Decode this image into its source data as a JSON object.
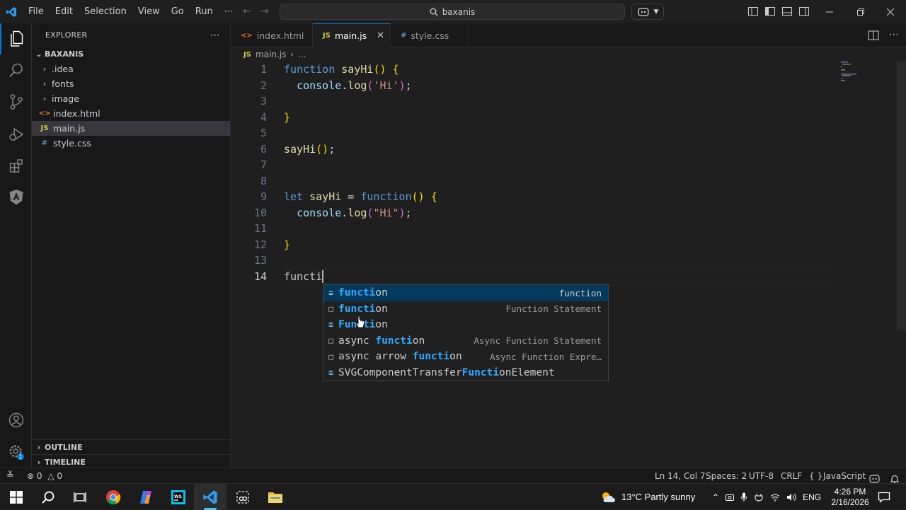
{
  "menu": [
    "File",
    "Edit",
    "Selection",
    "View",
    "Go",
    "Run",
    "⋯"
  ],
  "search": {
    "text": "baxanis"
  },
  "explorer": {
    "title": "EXPLORER",
    "more": "⋯",
    "root": "BAXANIS",
    "items": [
      {
        "label": ".idea",
        "type": "folder"
      },
      {
        "label": "fonts",
        "type": "folder"
      },
      {
        "label": "image",
        "type": "folder"
      },
      {
        "label": "index.html",
        "type": "html",
        "icon": "<>"
      },
      {
        "label": "main.js",
        "type": "js",
        "icon": "JS"
      },
      {
        "label": "style.css",
        "type": "css",
        "icon": "#"
      }
    ],
    "outline": "OUTLINE",
    "timeline": "TIMELINE"
  },
  "tabs": [
    {
      "label": "index.html",
      "icon": "<>"
    },
    {
      "label": "main.js",
      "icon": "JS",
      "close": "✕"
    },
    {
      "label": "style.css",
      "icon": "#"
    }
  ],
  "breadcrumb": {
    "icon": "JS",
    "file": "main.js",
    "sep": "›",
    "more": "..."
  },
  "line_numbers": [
    "1",
    "2",
    "3",
    "4",
    "5",
    "6",
    "7",
    "8",
    "9",
    "10",
    "11",
    "12",
    "13",
    "14"
  ],
  "code": {
    "l1": {
      "kw": "function",
      "name": "sayHi",
      "parens": "()",
      "brace": "{"
    },
    "l2": {
      "obj": "console",
      "dot": ".",
      "method": "log",
      "open": "(",
      "str": "'Hi'",
      "close": ");"
    },
    "l4": "}",
    "l6": {
      "name": "sayHi",
      "rest": "();"
    },
    "l9": {
      "kw": "let",
      "name": "sayHi",
      "eq": " = ",
      "fkw": "function",
      "parens": "()",
      "brace": "{"
    },
    "l10": {
      "obj": "console",
      "dot": ".",
      "method": "log",
      "open": "(",
      "str": "\"Hi\"",
      "close": ");"
    },
    "l12": "}",
    "l14": "functi"
  },
  "suggestions": [
    {
      "pre": "",
      "match": "functi",
      "post": "on",
      "detail": "function",
      "kind": "≡"
    },
    {
      "pre": "",
      "match": "functi",
      "post": "on",
      "detail": "Function Statement",
      "kind": "□"
    },
    {
      "pre": "",
      "match": "Functi",
      "post": "on",
      "detail": "",
      "kind": "⧈"
    },
    {
      "pre": "async ",
      "match": "functi",
      "post": "on",
      "detail": "Async Function Statement",
      "kind": "□"
    },
    {
      "pre": "async arrow ",
      "match": "functi",
      "post": "on",
      "detail": "Async Function Expre…",
      "kind": "□"
    },
    {
      "pre": "SVGComponentTransfer",
      "match": "Functi",
      "post": "onElement",
      "detail": "",
      "kind": "⧈"
    }
  ],
  "status": {
    "errors": "0",
    "warnings": "0",
    "position": "Ln 14, Col 7",
    "spaces": "Spaces: 2",
    "encoding": "UTF-8",
    "eol": "CRLF",
    "braces": "{ }",
    "language": "JavaScript"
  },
  "taskbar": {
    "weather": "13°C  Partly sunny",
    "lang": "ENG",
    "time": "4:26 PM",
    "date": "2/16/2026"
  },
  "colors": {
    "accent": "#0078d4",
    "match": "#2aaaff",
    "selection": "#04395e"
  }
}
